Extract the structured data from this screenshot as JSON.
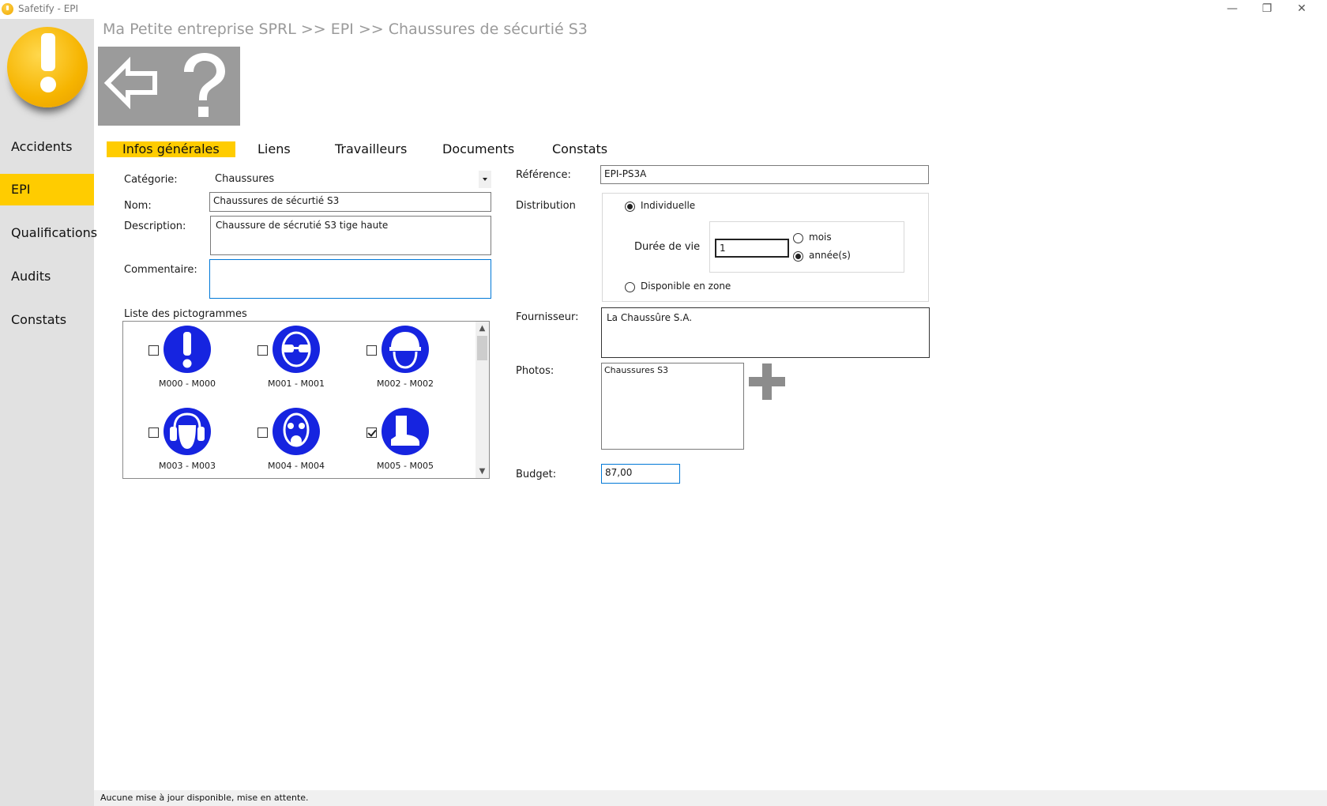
{
  "window": {
    "title": "Safetify - EPI",
    "minimize": "—",
    "restore": "❐",
    "close": "✕"
  },
  "sidebar": {
    "items": [
      {
        "label": "Accidents"
      },
      {
        "label": "EPI",
        "active": true
      },
      {
        "label": "Qualifications"
      },
      {
        "label": "Audits"
      },
      {
        "label": "Constats"
      }
    ]
  },
  "header": {
    "breadcrumb": "Ma Petite entreprise SPRL >> EPI >> Chaussures de sécurtié S3",
    "toolbar": {
      "back_icon": "arrow-left-icon",
      "help_icon": "help-icon"
    }
  },
  "tabs": [
    {
      "label": "Infos générales",
      "active": true
    },
    {
      "label": "Liens"
    },
    {
      "label": "Travailleurs"
    },
    {
      "label": "Documents"
    },
    {
      "label": "Constats"
    }
  ],
  "form": {
    "categorie_label": "Catégorie:",
    "categorie_value": "Chaussures",
    "nom_label": "Nom:",
    "nom_value": "Chaussures de sécurtié S3",
    "description_label": "Description:",
    "description_value": "Chaussure de sécrutié S3 tige haute",
    "commentaire_label": "Commentaire:",
    "commentaire_value": "",
    "pictos_label": "Liste des pictogrammes",
    "pictograms": [
      {
        "caption": "M000 - M000",
        "checked": false,
        "icon": "exclamation-icon"
      },
      {
        "caption": "M001 - M001",
        "checked": false,
        "icon": "safety-glasses-icon"
      },
      {
        "caption": "M002 - M002",
        "checked": false,
        "icon": "hard-hat-icon"
      },
      {
        "caption": "M003 - M003",
        "checked": false,
        "icon": "ear-protection-icon"
      },
      {
        "caption": "M004 - M004",
        "checked": false,
        "icon": "gas-mask-icon"
      },
      {
        "caption": "M005 - M005",
        "checked": true,
        "icon": "safety-boot-icon"
      }
    ],
    "reference_label": "Référence:",
    "reference_value": "EPI-PS3A",
    "distribution_label": "Distribution",
    "individuelle_label": "Individuelle",
    "individuelle_selected": true,
    "duree_label": "Durée de vie",
    "duree_value": "1",
    "mois_label": "mois",
    "annees_label": "année(s)",
    "unit_selected": "année(s)",
    "disponible_label": "Disponible en zone",
    "fournisseur_label": "Fournisseur:",
    "fournisseur_value": "La Chaussûre S.A.",
    "photos_label": "Photos:",
    "photos_items": [
      "Chaussures S3"
    ],
    "add_photo_icon": "plus-icon",
    "budget_label": "Budget:",
    "budget_value": "87,00"
  },
  "status": {
    "message": "Aucune mise à jour disponible, mise en attente."
  },
  "colors": {
    "accent": "#ffcc00",
    "picto_blue": "#1624e0",
    "toolbar_gray": "#9b9b9b",
    "sidebar_gray": "#e1e1e1",
    "breadcrumb_gray": "#9a9a9a"
  }
}
